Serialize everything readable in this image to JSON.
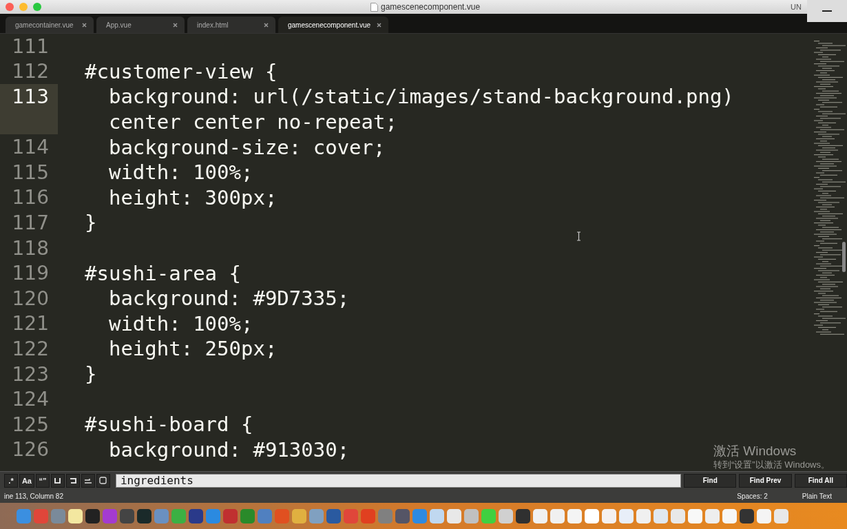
{
  "window": {
    "title": "gamescenecomponent.vue",
    "corner_text": "UN"
  },
  "tabs": [
    {
      "label": "gamecontainer.vue",
      "selected": false
    },
    {
      "label": "App.vue",
      "selected": false
    },
    {
      "label": "index.html",
      "selected": false
    },
    {
      "label": "gamescenecomponent.vue",
      "selected": true
    }
  ],
  "editor": {
    "lines": [
      {
        "number": "111",
        "rows": [
          ""
        ],
        "current": false
      },
      {
        "number": "112",
        "rows": [
          "#customer-view {"
        ],
        "current": false
      },
      {
        "number": "113",
        "rows": [
          "  background: url(/static/images/stand-background.png)",
          "  center center no-repeat;"
        ],
        "current": true
      },
      {
        "number": "114",
        "rows": [
          "  background-size: cover;"
        ],
        "current": false
      },
      {
        "number": "115",
        "rows": [
          "  width: 100%;"
        ],
        "current": false
      },
      {
        "number": "116",
        "rows": [
          "  height: 300px;"
        ],
        "current": false
      },
      {
        "number": "117",
        "rows": [
          "}"
        ],
        "current": false
      },
      {
        "number": "118",
        "rows": [
          ""
        ],
        "current": false
      },
      {
        "number": "119",
        "rows": [
          "#sushi-area {"
        ],
        "current": false
      },
      {
        "number": "120",
        "rows": [
          "  background: #9D7335;"
        ],
        "current": false
      },
      {
        "number": "121",
        "rows": [
          "  width: 100%;"
        ],
        "current": false
      },
      {
        "number": "122",
        "rows": [
          "  height: 250px;"
        ],
        "current": false
      },
      {
        "number": "123",
        "rows": [
          "}"
        ],
        "current": false
      },
      {
        "number": "124",
        "rows": [
          ""
        ],
        "current": false
      },
      {
        "number": "125",
        "rows": [
          "#sushi-board {"
        ],
        "current": false
      },
      {
        "number": "126",
        "rows": [
          "  background: #913030;"
        ],
        "current": false
      }
    ]
  },
  "find_bar": {
    "toggles": [
      {
        "label": ".*",
        "on": false
      },
      {
        "label": "Aa",
        "on": false
      },
      {
        "label": "“”",
        "on": false
      }
    ],
    "value": "ingredients",
    "buttons": [
      "Find",
      "Find Prev",
      "Find All"
    ]
  },
  "status_bar": {
    "position": "ine 113, Column 82",
    "indent": "Spaces: 2",
    "syntax": "Plain Text"
  },
  "activation": {
    "title": "激活 Windows",
    "hint": "转到“设置”以激活 Windows。"
  }
}
